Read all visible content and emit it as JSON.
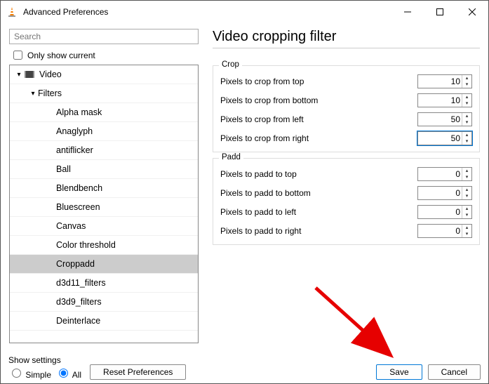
{
  "window": {
    "title": "Advanced Preferences"
  },
  "search": {
    "placeholder": "Search"
  },
  "only_show_current_label": "Only show current",
  "only_show_current_checked": false,
  "tree": {
    "video_label": "Video",
    "filters_label": "Filters",
    "items": [
      "Alpha mask",
      "Anaglyph",
      "antiflicker",
      "Ball",
      "Blendbench",
      "Bluescreen",
      "Canvas",
      "Color threshold",
      "Croppadd",
      "d3d11_filters",
      "d3d9_filters",
      "Deinterlace"
    ],
    "selected_index": 8
  },
  "panel": {
    "heading": "Video cropping filter",
    "crop": {
      "legend": "Crop",
      "top_label": "Pixels to crop from top",
      "top_value": "10",
      "bottom_label": "Pixels to crop from bottom",
      "bottom_value": "10",
      "left_label": "Pixels to crop from left",
      "left_value": "50",
      "right_label": "Pixels to crop from right",
      "right_value": "50"
    },
    "padd": {
      "legend": "Padd",
      "top_label": "Pixels to padd to top",
      "top_value": "0",
      "bottom_label": "Pixels to padd to bottom",
      "bottom_value": "0",
      "left_label": "Pixels to padd to left",
      "left_value": "0",
      "right_label": "Pixels to padd to right",
      "right_value": "0"
    }
  },
  "footer": {
    "show_settings_label": "Show settings",
    "simple_label": "Simple",
    "all_label": "All",
    "selected_mode": "All",
    "reset_label": "Reset Preferences",
    "save_label": "Save",
    "cancel_label": "Cancel"
  }
}
